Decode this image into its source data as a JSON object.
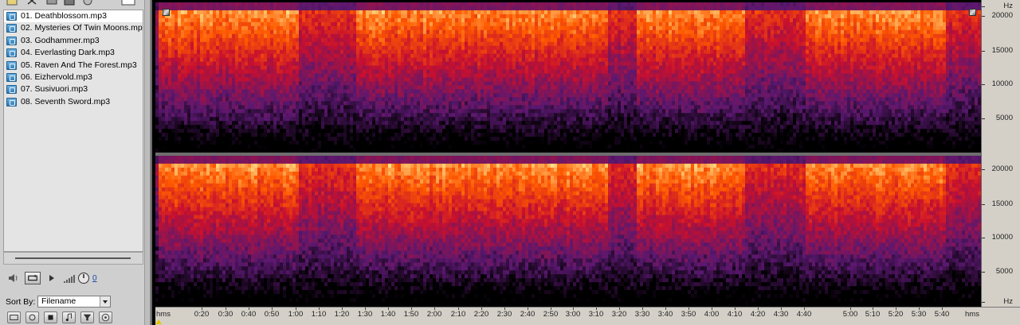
{
  "file_panel": {
    "files": [
      {
        "label": "01. Deathblossom.mp3",
        "selected": true
      },
      {
        "label": "02. Mysteries Of Twin Moons.mp3",
        "selected": false
      },
      {
        "label": "03. Godhammer.mp3",
        "selected": false
      },
      {
        "label": "04. Everlasting Dark.mp3",
        "selected": false
      },
      {
        "label": "05. Raven And The Forest.mp3",
        "selected": false
      },
      {
        "label": "06. Eizhervold.mp3",
        "selected": false
      },
      {
        "label": "07. Susivuori.mp3",
        "selected": false
      },
      {
        "label": "08. Seventh Sword.mp3",
        "selected": false
      }
    ],
    "volume_value": "0",
    "sort_by": {
      "label": "Sort By:",
      "value": "Filename"
    }
  },
  "spectral_view": {
    "channels": 2,
    "frequency_axis": {
      "unit_top": "Hz",
      "unit_bottom": "Hz",
      "ticks": [
        "20000",
        "15000",
        "10000",
        "5000"
      ]
    },
    "time_axis": {
      "unit_left": "hms",
      "unit_right": "hms",
      "ticks": [
        "0:20",
        "0:30",
        "0:40",
        "0:50",
        "1:00",
        "1:10",
        "1:20",
        "1:30",
        "1:40",
        "1:50",
        "2:00",
        "2:10",
        "2:20",
        "2:30",
        "2:40",
        "2:50",
        "3:00",
        "3:10",
        "3:20",
        "3:30",
        "3:40",
        "3:50",
        "4:00",
        "4:10",
        "4:20",
        "4:30",
        "4:40",
        "5:00",
        "5:10",
        "5:20",
        "5:30",
        "5:40"
      ]
    },
    "colors": {
      "hot": "#ffe08a",
      "mid": "#ff5a00",
      "red": "#c8102e",
      "purple": "#5a1870",
      "bg": "#000000"
    }
  }
}
